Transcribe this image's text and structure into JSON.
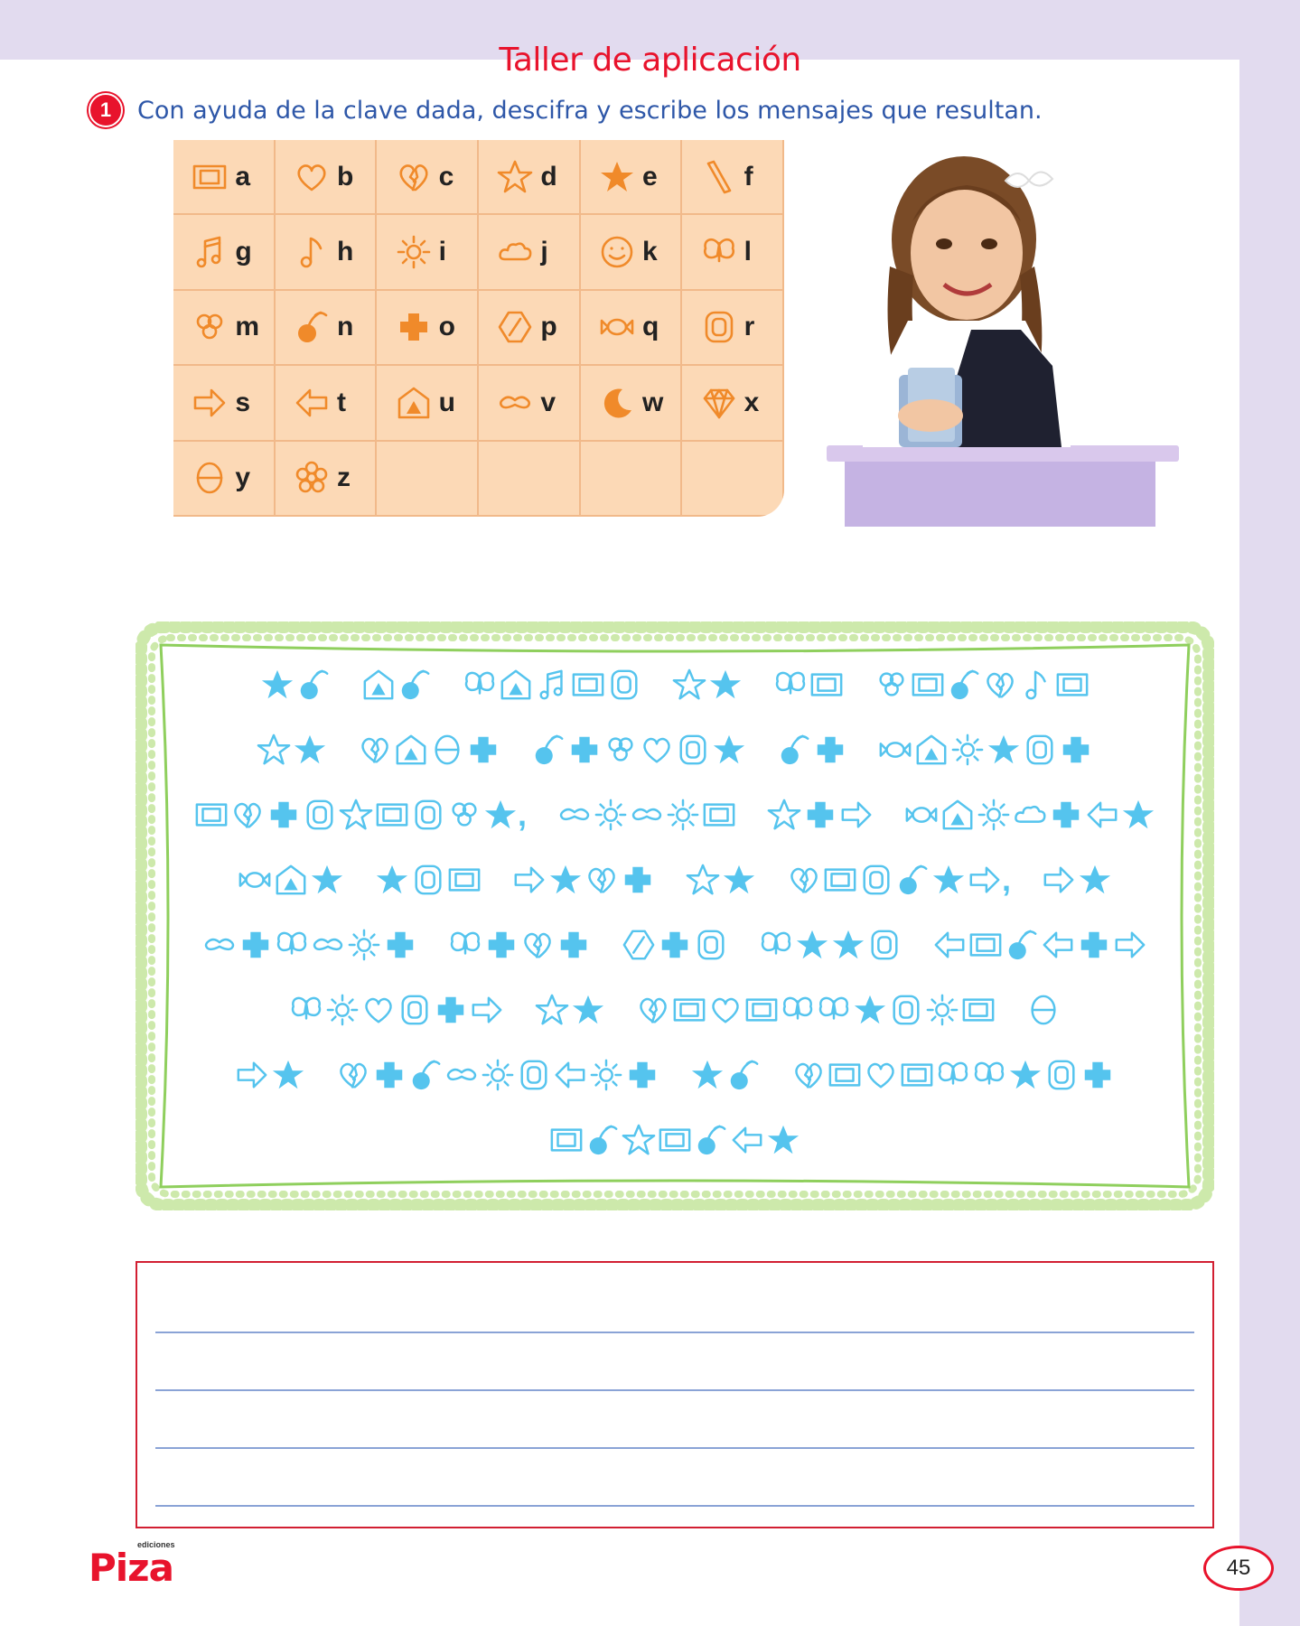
{
  "title": "Taller de aplicación",
  "instruction": {
    "number": "1",
    "text": "Con ayuda de la clave dada, descifra y escribe los mensajes que resultan."
  },
  "key": [
    {
      "letter": "a",
      "icon": "square-frame-icon"
    },
    {
      "letter": "b",
      "icon": "heart-icon"
    },
    {
      "letter": "c",
      "icon": "broken-heart-icon"
    },
    {
      "letter": "d",
      "icon": "star-outline-icon"
    },
    {
      "letter": "e",
      "icon": "star-solid-icon"
    },
    {
      "letter": "f",
      "icon": "slash-bar-icon"
    },
    {
      "letter": "g",
      "icon": "double-music-note-icon"
    },
    {
      "letter": "h",
      "icon": "music-note-icon"
    },
    {
      "letter": "i",
      "icon": "sun-icon"
    },
    {
      "letter": "j",
      "icon": "cloud-icon"
    },
    {
      "letter": "k",
      "icon": "smiley-icon"
    },
    {
      "letter": "l",
      "icon": "butterfly-icon"
    },
    {
      "letter": "m",
      "icon": "clover-icon"
    },
    {
      "letter": "n",
      "icon": "cherry-icon"
    },
    {
      "letter": "o",
      "icon": "cross-icon"
    },
    {
      "letter": "p",
      "icon": "hexagon-icon"
    },
    {
      "letter": "q",
      "icon": "candy-icon"
    },
    {
      "letter": "r",
      "icon": "rounded-square-icon"
    },
    {
      "letter": "s",
      "icon": "arrow-right-icon"
    },
    {
      "letter": "t",
      "icon": "arrow-left-icon"
    },
    {
      "letter": "u",
      "icon": "house-icon"
    },
    {
      "letter": "v",
      "icon": "mustache-icon"
    },
    {
      "letter": "w",
      "icon": "moon-icon"
    },
    {
      "letter": "x",
      "icon": "diamond-icon"
    },
    {
      "letter": "y",
      "icon": "theta-icon"
    },
    {
      "letter": "z",
      "icon": "flower-icon"
    }
  ],
  "message_lines": [
    [
      "en",
      "un",
      "lugar",
      "de",
      "la",
      "mancha"
    ],
    [
      "de",
      "cuyo",
      "nombre",
      "no",
      "quiero"
    ],
    [
      "acordarme,",
      "vivia",
      "dos",
      "quijote"
    ],
    [
      "que",
      "era",
      "seco",
      "de",
      "carnes,",
      "se"
    ],
    [
      "volvio",
      "loco",
      "por",
      "leer",
      "tantos"
    ],
    [
      "libros",
      "de",
      "caballeria",
      "y"
    ],
    [
      "se",
      "convirtio",
      "en",
      "caballero"
    ],
    [
      "andante"
    ]
  ],
  "brand": {
    "small": "ediciones",
    "name": "Piza"
  },
  "page_number": "45",
  "colors": {
    "title": "#e8132c",
    "instruction": "#2e57a8",
    "key_bg": "#fcd9b6",
    "key_icon": "#f08a2a",
    "cipher": "#55c4ee",
    "frame": "#b6e08d",
    "answer_border": "#d21f32",
    "answer_lines": "#8aa3d6"
  }
}
